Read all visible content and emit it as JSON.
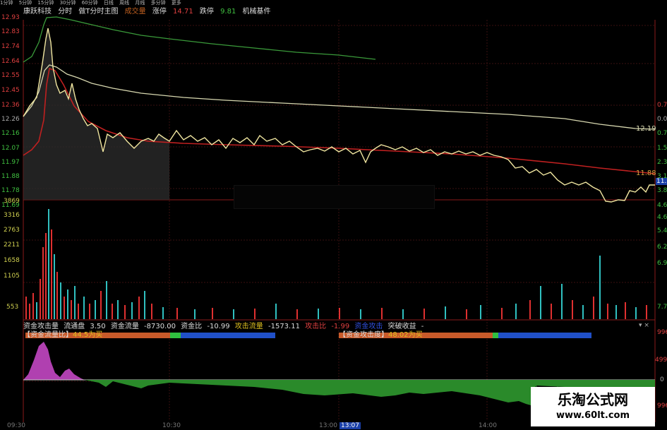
{
  "topbar": [
    "1分钟",
    "5分钟",
    "15分钟",
    "30分钟",
    "60分钟",
    "日线",
    "周线",
    "月线",
    "多分钟",
    "更多"
  ],
  "title": {
    "stock": "康跃科技",
    "mode": "分时",
    "indicator": "做T分时主图",
    "volume": "成交量",
    "limit_up_label": "涨停",
    "limit_up_value": "14.71",
    "limit_down_label": "跌停",
    "limit_down_value": "9.81",
    "sector": "机械基件"
  },
  "price_axis": [
    "12.93",
    "12.83",
    "12.74",
    "12.64",
    "12.55",
    "12.45",
    "12.36",
    "12.26",
    "12.16",
    "12.07",
    "11.97",
    "11.88",
    "11.78",
    "11.69"
  ],
  "pct_axis": [
    "0.7",
    "0.0",
    "0.7",
    "1.5",
    "2.3",
    "3.1",
    "3.8",
    "4.6",
    "5.4",
    "6.2",
    "6.9"
  ],
  "price_badge": "11.",
  "line_labels": {
    "avg": "12.19",
    "ma": "11.88"
  },
  "volume_axis": [
    "3869",
    "3316",
    "2763",
    "2211",
    "1658",
    "1105",
    "553"
  ],
  "volume_right_axis": [
    "4.6",
    "5.4",
    "6.2",
    "6.9",
    "7.7"
  ],
  "indicator_line": {
    "name": "资金攻击量",
    "float_label": "流通盘",
    "float_value": "3.50",
    "flow_label": "资金流量",
    "flow_value": "-8730.00",
    "ratio_label": "资金比",
    "ratio_value": "-10.99",
    "attack_label": "攻击流量",
    "attack_value": "-1573.11",
    "attack_ratio_label": "攻击比",
    "attack_ratio_value": "-1.99",
    "blue_label": "资金攻击",
    "profit_label": "突破收益",
    "profit_value": "-"
  },
  "bar1": {
    "label": "【资金流量比】",
    "value": "44.5",
    "tag": "为买"
  },
  "bar2": {
    "label": "【资金攻击度】",
    "value": "48.02",
    "tag": "为买"
  },
  "ind_right_axis": [
    "996",
    "4996",
    "0",
    "996"
  ],
  "time_axis": {
    "start": "09:30",
    "t1": "10:30",
    "t2": "13:00",
    "t3": "13:07",
    "t4": "14:00"
  },
  "watermark": {
    "name": "乐淘公式网",
    "url": "www.60lt.com"
  },
  "colors": {
    "bg": "#000000",
    "price": "#f0e6a0",
    "avg": "#d8d8b0",
    "ma": "#c02020",
    "green": "#3a9a3a",
    "up": "#e03030",
    "down": "#30c0c0",
    "magenta": "#b040b0",
    "flowgreen": "#2a8a2a"
  }
}
